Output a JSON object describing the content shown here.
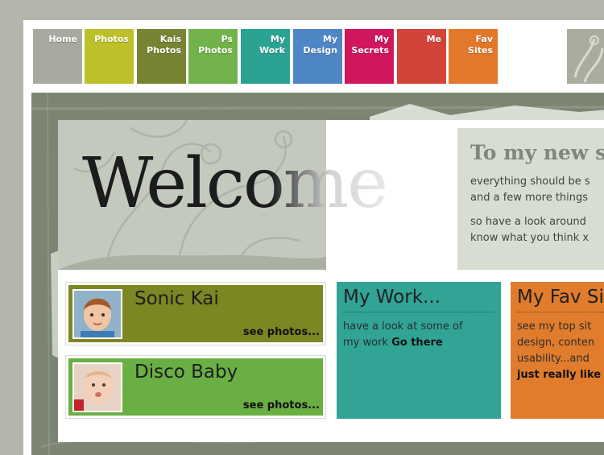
{
  "nav": {
    "tabs": [
      {
        "label": "Home",
        "color": "#a7aaa0"
      },
      {
        "label": "Photos",
        "color": "#bcc12a"
      },
      {
        "label": "Kais\nPhotos",
        "color": "#788333"
      },
      {
        "label": "Ps\nPhotos",
        "color": "#72b24a"
      },
      {
        "label": "My\nWork",
        "color": "#2ba393"
      },
      {
        "label": "My\nDesign",
        "color": "#4f86c6"
      },
      {
        "label": "My\nSecrets",
        "color": "#d0175e"
      },
      {
        "label": "Me",
        "color": "#d2443a"
      },
      {
        "label": "Fav\nSites",
        "color": "#e3782a"
      }
    ]
  },
  "hero": {
    "welcome": "Welcome",
    "intro_title": "To my new s",
    "intro_para1": "everything should be s\nand a few more things",
    "intro_para2": "so have a look around\nknow what you think x"
  },
  "cards": {
    "sonic": {
      "title": "Sonic Kai",
      "link": "see photos...",
      "color": "#7c8723"
    },
    "disco": {
      "title": "Disco Baby",
      "link": "see photos...",
      "color": "#6aaf43"
    },
    "work": {
      "title": "My Work...",
      "text": "have a look at some of\nmy work",
      "link": "Go there",
      "color": "#31a496"
    },
    "fav": {
      "title": "My Fav Si",
      "text": "see my top sit\ndesign, conten\nusability...and",
      "link": "just really like",
      "color": "#e07c2c"
    }
  }
}
